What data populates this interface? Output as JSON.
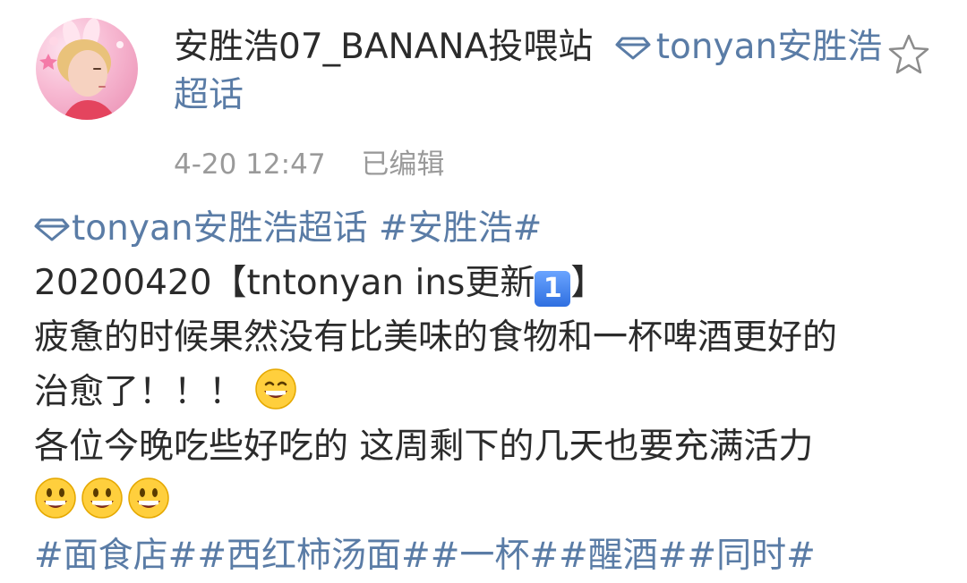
{
  "post": {
    "author": "安胜浩07_BANANA投喂站",
    "topic": "tonyan安胜浩超话",
    "topic_line2": "",
    "timestamp": "4-20 12:47",
    "edited": "已编辑",
    "body": {
      "tag_topic": "tonyan安胜浩超话",
      "tag_name": "#安胜浩#",
      "line1_prefix": "20200420【tntonyan ins更新",
      "keycap": "1",
      "line1_suffix": "】",
      "line2": "疲惫的时候果然没有比美味的食物和一杯啤酒更好的",
      "line3": "治愈了！！！",
      "line4": "各位今晚吃些好吃的 这周剩下的几天也要充满活力",
      "hashtags": "#面食店##西红柿汤面##一杯##醒酒##同时#"
    }
  },
  "icons": {
    "diamond": "diamond-icon",
    "star": "star-icon",
    "grin": "grinning-emoji",
    "smile": "smiling-emoji"
  },
  "colors": {
    "link": "#5a7ca6",
    "meta": "#9a9a9a",
    "text": "#2b2b2b"
  }
}
